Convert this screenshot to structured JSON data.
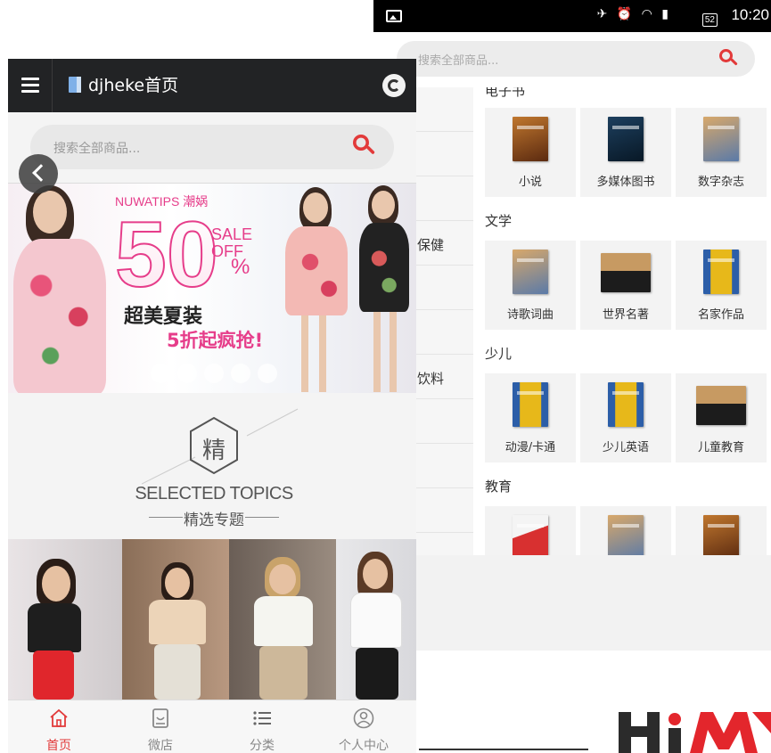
{
  "status_bar": {
    "time": "10:20",
    "battery": "52"
  },
  "category_page": {
    "search_placeholder": "搜索全部商品...",
    "sidebar_items": [
      "保健",
      "饮料"
    ],
    "sections": [
      {
        "title": "电子书",
        "items": [
          "小说",
          "多媒体图书",
          "数字杂志"
        ]
      },
      {
        "title": "文学",
        "items": [
          "诗歌词曲",
          "世界名著",
          "名家作品"
        ]
      },
      {
        "title": "少儿",
        "items": [
          "动漫/卡通",
          "少儿英语",
          "儿童教育"
        ]
      },
      {
        "title": "教育",
        "items": []
      }
    ]
  },
  "home_page": {
    "title": "djheke首页",
    "search_placeholder": "搜索全部商品...",
    "banner": {
      "brand": "NUWATIPS 潮娲",
      "big_number": "50",
      "sale": "SALE",
      "off": "OFF",
      "percent": "%",
      "headline": "超美夏装",
      "subline": "5折起疯抢!"
    },
    "topics": {
      "char": "精",
      "title_en": "SELECTED TOPICS",
      "title_zh": "精选专题"
    },
    "tabs": [
      {
        "label": "首页",
        "icon": "home-icon",
        "active": true
      },
      {
        "label": "微店",
        "icon": "shop-icon",
        "active": false
      },
      {
        "label": "分类",
        "icon": "list-icon",
        "active": false
      },
      {
        "label": "个人中心",
        "icon": "user-icon",
        "active": false
      }
    ]
  },
  "logo": {
    "text": "HiM"
  },
  "colors": {
    "accent": "#e23a3a",
    "topbar": "#222325",
    "pink": "#e63d8a"
  }
}
